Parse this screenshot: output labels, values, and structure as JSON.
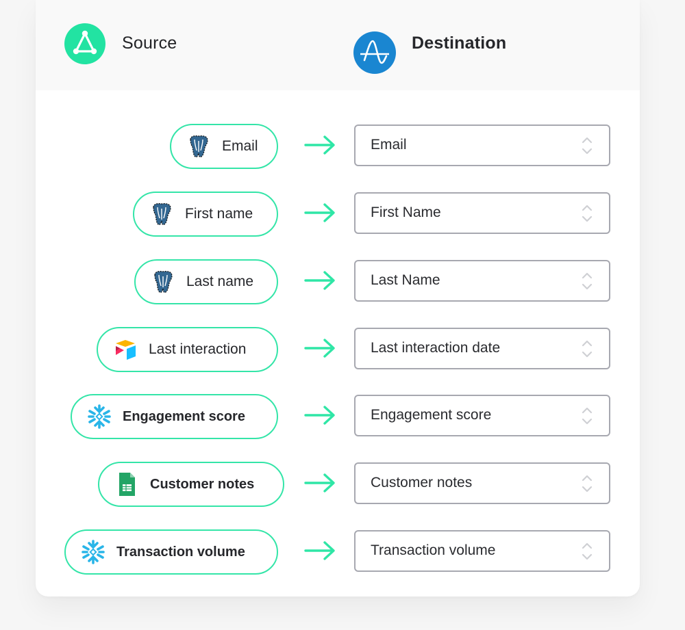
{
  "header": {
    "source_label": "Source",
    "destination_label": "Destination",
    "source_icon": "census-triangle-icon",
    "destination_icon": "amplitude-icon"
  },
  "colors": {
    "accent_green": "#22e3a2",
    "pill_border": "#34e5a8",
    "destination_blue": "#1a86d1",
    "select_border": "#a7a8b0"
  },
  "mappings": [
    {
      "source": "Email",
      "source_icon": "postgresql-icon",
      "destination": "Email"
    },
    {
      "source": "First name",
      "source_icon": "postgresql-icon",
      "destination": "First Name"
    },
    {
      "source": "Last name",
      "source_icon": "postgresql-icon",
      "destination": "Last Name"
    },
    {
      "source": "Last interaction",
      "source_icon": "airtable-icon",
      "destination": "Last interaction date"
    },
    {
      "source": "Engagement score",
      "source_icon": "snowflake-icon",
      "destination": "Engagement score"
    },
    {
      "source": "Customer notes",
      "source_icon": "google-sheets-icon",
      "destination": "Customer notes"
    },
    {
      "source": "Transaction volume",
      "source_icon": "snowflake-icon",
      "destination": "Transaction volume"
    }
  ]
}
